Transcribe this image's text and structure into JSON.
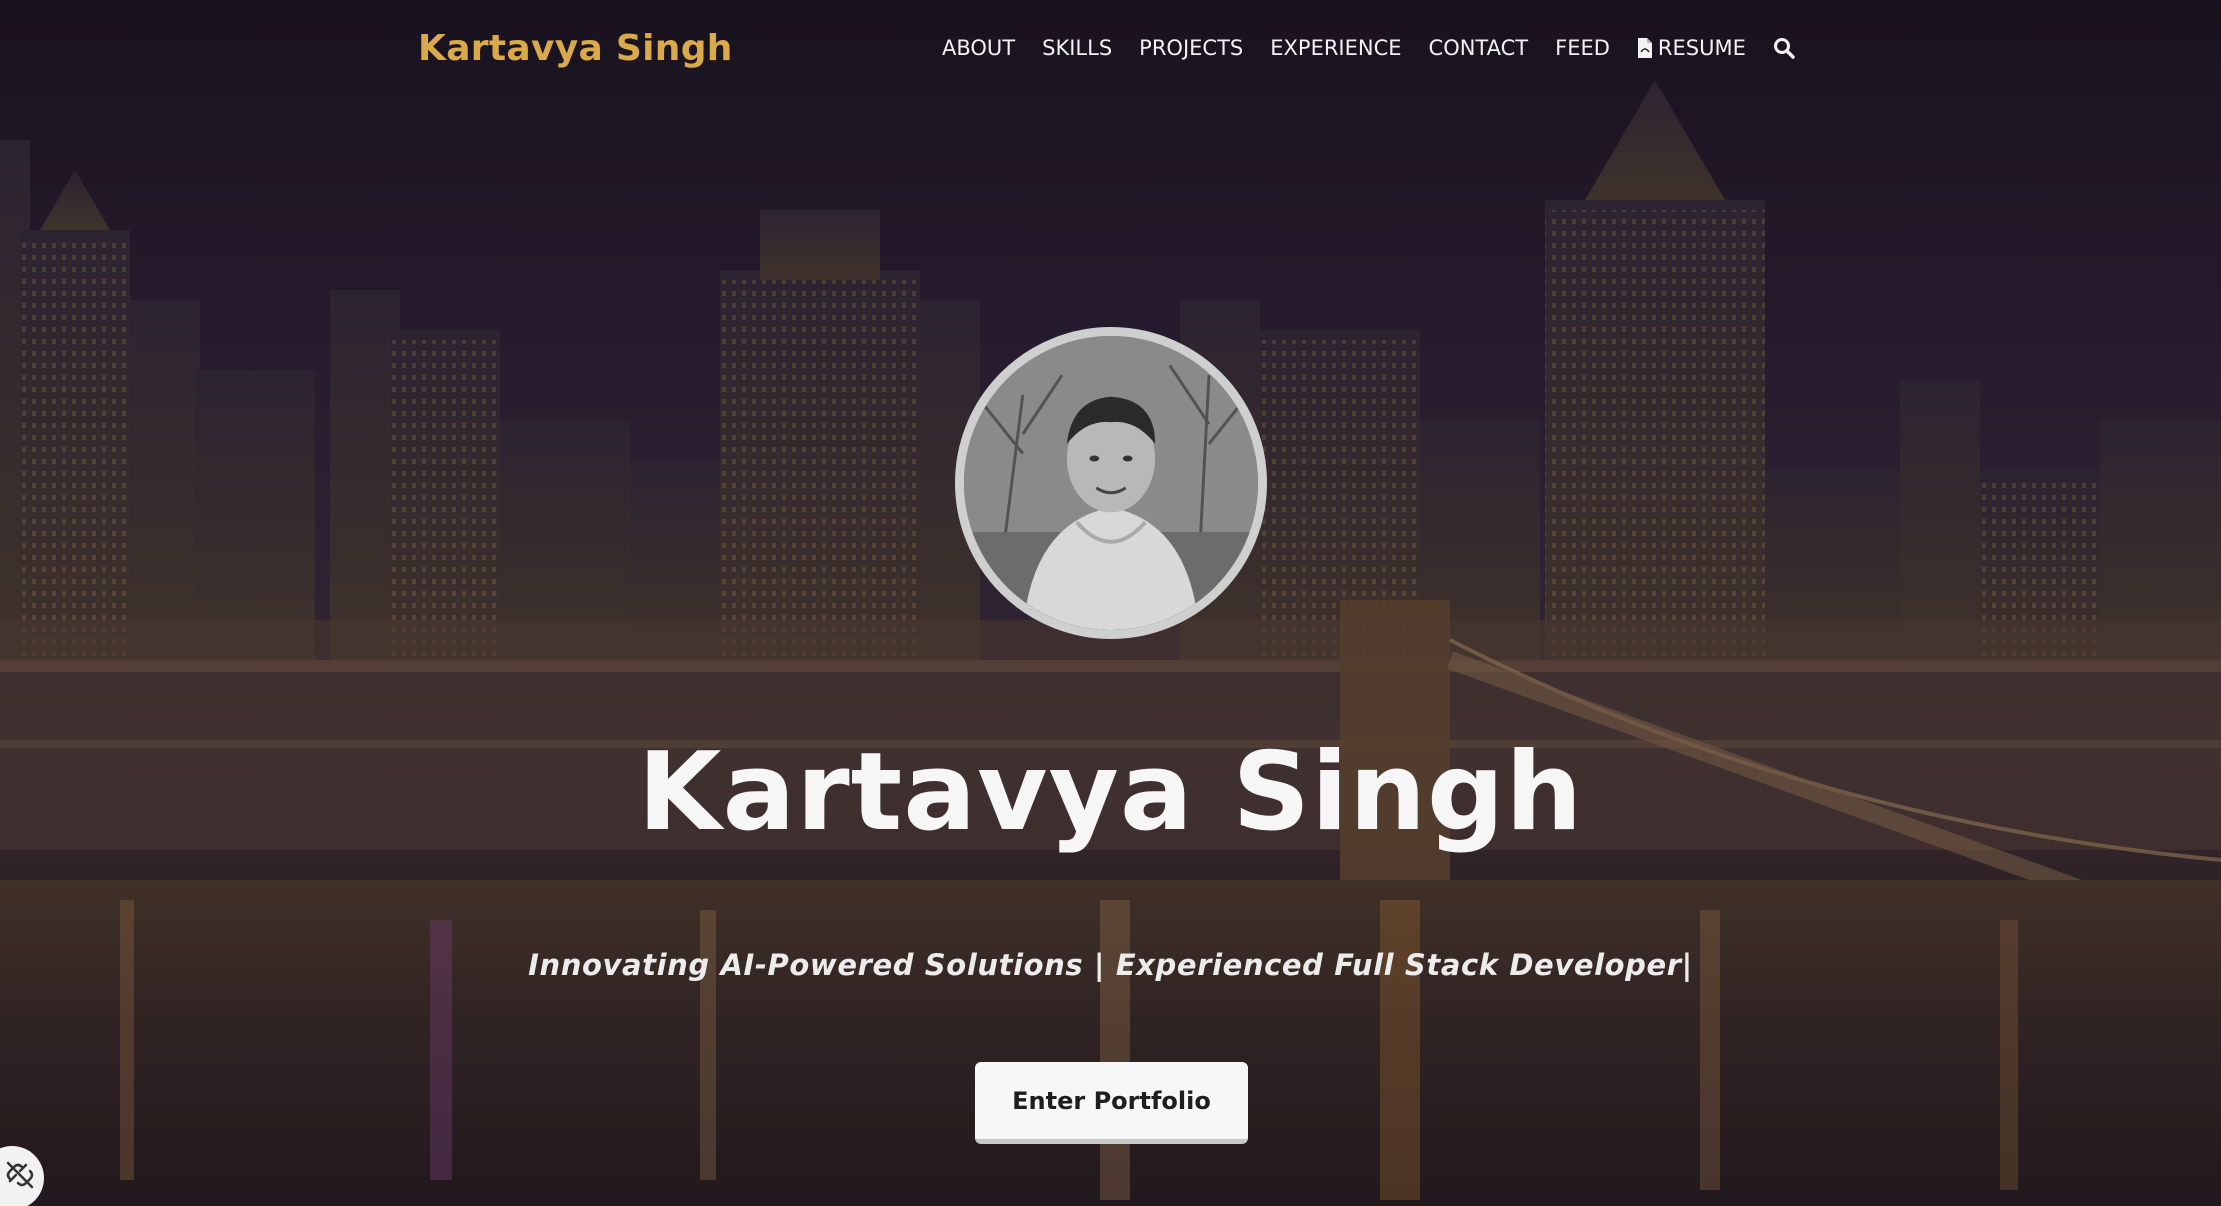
{
  "nav": {
    "brand": "Kartavya Singh",
    "links": [
      {
        "label": "ABOUT"
      },
      {
        "label": "SKILLS"
      },
      {
        "label": "PROJECTS"
      },
      {
        "label": "EXPERIENCE"
      },
      {
        "label": "CONTACT"
      },
      {
        "label": "FEED"
      },
      {
        "label": "RESUME",
        "icon": "pdf-file-icon"
      }
    ],
    "search_icon": "search-icon"
  },
  "hero": {
    "avatar_icon": "profile-photo",
    "title": "Kartavya Singh",
    "subtitle": "Innovating AI-Powered Solutions | Experienced Full Stack Developer|",
    "cta_label": "Enter Portfolio"
  },
  "corner_badge": {
    "icon": "link-off-icon"
  },
  "colors": {
    "brand": "#d9a94a",
    "nav_text": "#f2f2f2",
    "button_bg": "#f7f7f7",
    "avatar_border": "#cfcfcf"
  }
}
